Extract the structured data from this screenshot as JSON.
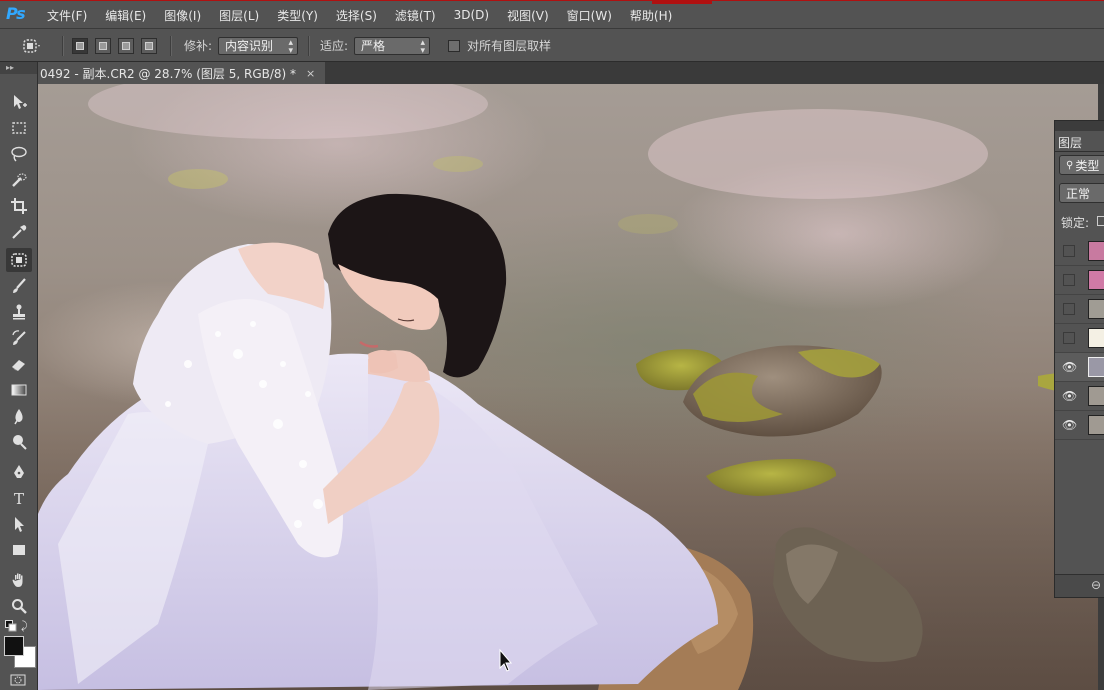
{
  "app": {
    "logo": "Ps",
    "accent": "#31a8ff"
  },
  "menu": [
    "文件(F)",
    "编辑(E)",
    "图像(I)",
    "图层(L)",
    "类型(Y)",
    "选择(S)",
    "滤镜(T)",
    "3D(D)",
    "视图(V)",
    "窗口(W)",
    "帮助(H)"
  ],
  "options": {
    "patch_label": "修补:",
    "patch_value": "内容识别",
    "adapt_label": "适应:",
    "adapt_value": "严格",
    "sample_all_label": "对所有图层取样",
    "sample_all_checked": false
  },
  "document": {
    "tab_title": "0492 - 副本.CR2 @ 28.7% (图层 5, RGB/8) *",
    "close": "×"
  },
  "tools": [
    "move-icon",
    "marquee-icon",
    "lasso-icon",
    "quick-select-icon",
    "crop-icon",
    "eyedropper-icon",
    "patch-icon",
    "brush-icon",
    "stamp-icon",
    "history-brush-icon",
    "eraser-icon",
    "gradient-icon",
    "blur-icon",
    "dodge-icon",
    "pen-icon",
    "type-icon",
    "path-select-icon",
    "rectangle-icon",
    "hand-icon",
    "zoom-icon"
  ],
  "selected_tool": "patch-icon",
  "layers_panel": {
    "tab": "图层",
    "filter": "类型",
    "blend_mode": "正常",
    "lock_label": "锁定:",
    "layers": [
      {
        "visible": false,
        "thumb": "#c87aa0"
      },
      {
        "visible": false,
        "thumb": "#d07aa6"
      },
      {
        "visible": false,
        "thumb": "#a09c94"
      },
      {
        "visible": false,
        "thumb": "#f4f0e4"
      },
      {
        "visible": true,
        "thumb": "#9a98a6",
        "selected": true
      },
      {
        "visible": true,
        "thumb": "#a09a92"
      },
      {
        "visible": true,
        "thumb": "#a09a92"
      }
    ]
  }
}
